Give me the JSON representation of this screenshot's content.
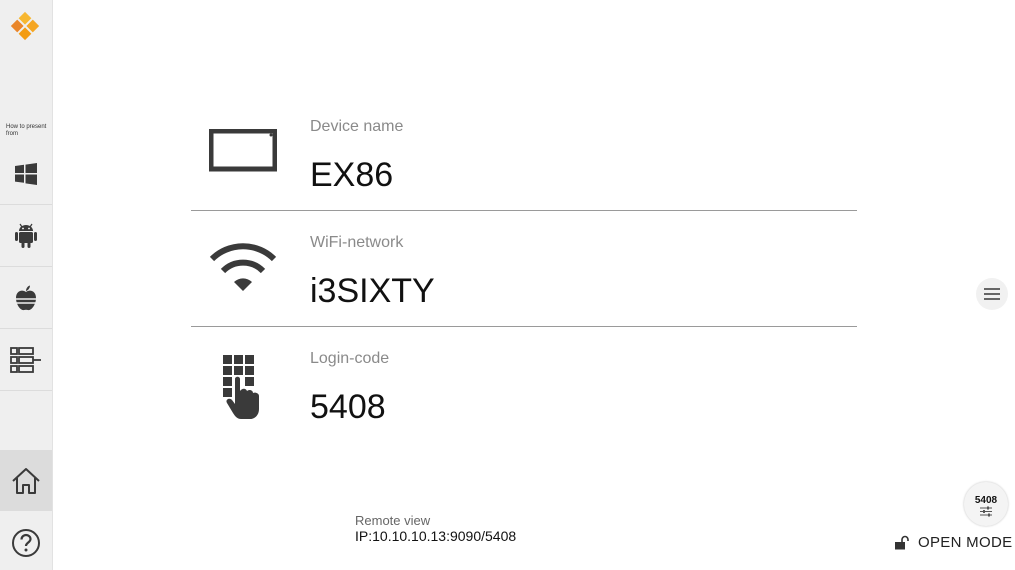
{
  "sidebar": {
    "howto_text": "How to present from",
    "items": [
      {
        "name": "windows",
        "icon": "windows-icon"
      },
      {
        "name": "android",
        "icon": "android-icon"
      },
      {
        "name": "apple",
        "icon": "apple-icon"
      },
      {
        "name": "list",
        "icon": "list-settings-icon"
      },
      {
        "name": "home",
        "icon": "home-icon",
        "active": true
      },
      {
        "name": "help",
        "icon": "help-icon"
      }
    ]
  },
  "device": {
    "label": "Device name",
    "value": "EX86",
    "icon": "display-icon"
  },
  "wifi": {
    "label": "WiFi-network",
    "value": "i3SIXTY",
    "icon": "wifi-icon"
  },
  "login": {
    "label": "Login-code",
    "value": "5408",
    "icon": "keypad-hand-icon"
  },
  "remote": {
    "label": "Remote view",
    "ip": "IP:10.10.10.13:9090/5408"
  },
  "badge": {
    "code": "5408",
    "icon": "sliders-icon"
  },
  "mode": {
    "label": "OPEN MODE",
    "icon": "unlock-icon"
  },
  "menu": {
    "icon": "hamburger-icon"
  },
  "colors": {
    "accent": "#f5a623",
    "accent_dark": "#e07b00",
    "icon": "#3a3a3a",
    "sidebar_bg": "#efefef"
  }
}
